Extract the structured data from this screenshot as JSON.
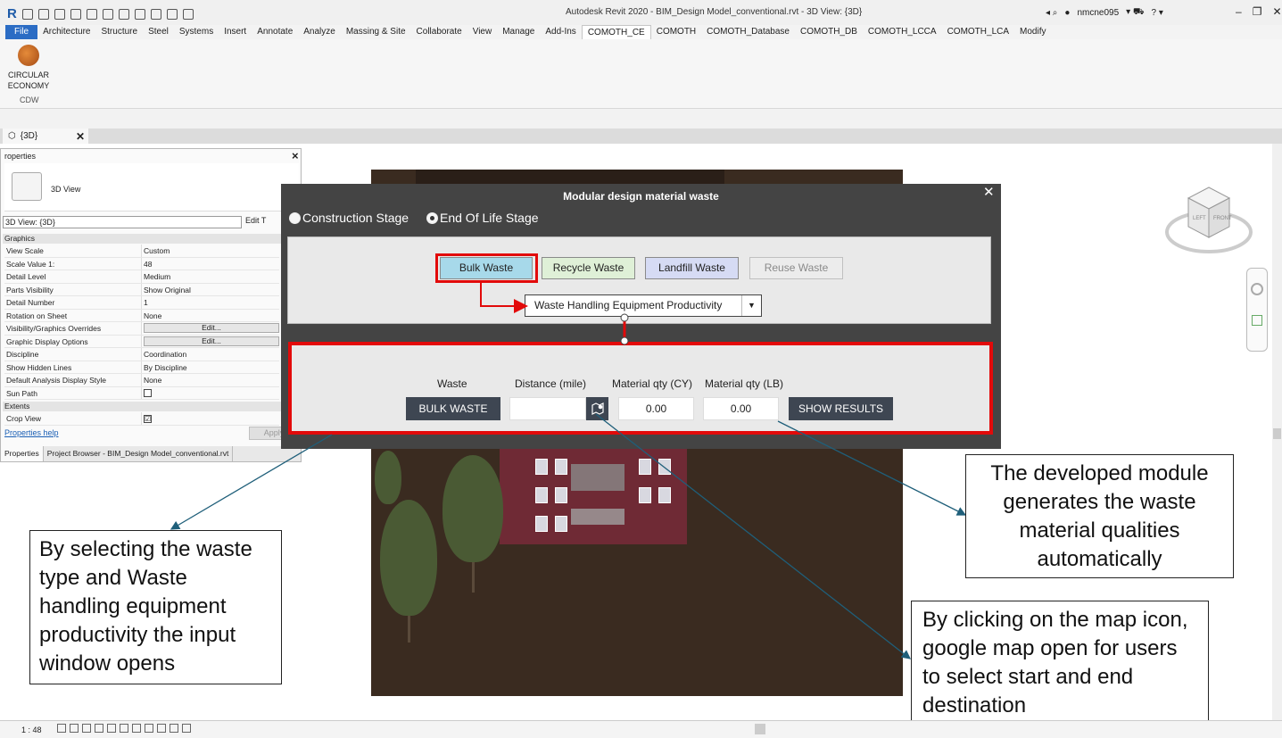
{
  "app": {
    "window_title": "Autodesk Revit 2020 - BIM_Design Model_conventional.rvt - 3D View: {3D}",
    "username": "nmcne095",
    "logo": "R"
  },
  "menu": {
    "items": [
      "File",
      "Architecture",
      "Structure",
      "Steel",
      "Systems",
      "Insert",
      "Annotate",
      "Analyze",
      "Massing & Site",
      "Collaborate",
      "View",
      "Manage",
      "Add-Ins",
      "COMOTH_CE",
      "COMOTH",
      "COMOTH_Database",
      "COMOTH_DB",
      "COMOTH_LCCA",
      "COMOTH_LCA",
      "Modify"
    ],
    "active": "COMOTH_CE"
  },
  "ribbon": {
    "circular_economy_label": "CIRCULAR ECONOMY",
    "panel_label": "CDW"
  },
  "view_tab": {
    "label": "{3D}",
    "close": "✕"
  },
  "properties": {
    "title": "roperties",
    "type_name": "3D View",
    "selector": "3D View: {3D}",
    "edit_type": "Edit T",
    "groups": {
      "graphics": "Graphics",
      "extents": "Extents"
    },
    "rows": [
      {
        "key": "View Scale",
        "value": "Custom"
      },
      {
        "key": "Scale Value    1:",
        "value": "48"
      },
      {
        "key": "Detail Level",
        "value": "Medium"
      },
      {
        "key": "Parts Visibility",
        "value": "Show Original"
      },
      {
        "key": "Detail Number",
        "value": "1"
      },
      {
        "key": "Rotation on Sheet",
        "value": "None"
      },
      {
        "key": "Visibility/Graphics Overrides",
        "value": "Edit..."
      },
      {
        "key": "Graphic Display Options",
        "value": "Edit..."
      },
      {
        "key": "Discipline",
        "value": "Coordination"
      },
      {
        "key": "Show Hidden Lines",
        "value": "By Discipline"
      },
      {
        "key": "Default Analysis Display Style",
        "value": "None"
      },
      {
        "key": "Sun Path",
        "value": ""
      }
    ],
    "extents_rows": [
      {
        "key": "Crop View",
        "value": "☑"
      }
    ],
    "help_link": "Properties help",
    "apply": "Apply",
    "tabs": [
      "Properties",
      "Project Browser - BIM_Design Model_conventional.rvt"
    ]
  },
  "dialog": {
    "title": "Modular design material waste",
    "close": "✕",
    "stage_options": [
      {
        "label": "Construction Stage",
        "selected": false
      },
      {
        "label": "End Of Life Stage",
        "selected": true
      }
    ],
    "waste_buttons": {
      "bulk": "Bulk Waste",
      "recycle": "Recycle Waste",
      "landfill": "Landfill Waste",
      "reuse": "Reuse Waste"
    },
    "equipment_select": "Waste Handling Equipment Productivity",
    "columns": {
      "waste": "Waste",
      "distance": "Distance (mile)",
      "qty_cy": "Material qty (CY)",
      "qty_lb": "Material qty (LB)"
    },
    "bulk_waste_button": "BULK WASTE",
    "distance_value": "",
    "qty_cy_value": "0.00",
    "qty_lb_value": "0.00",
    "show_results": "SHOW RESULTS"
  },
  "notes": {
    "left": "By selecting the waste type and Waste handling equipment productivity the input window opens",
    "right": "The developed module generates the waste material qualities automatically",
    "map": "By clicking on the map icon,  google map open for users to select start and end destination"
  },
  "status": {
    "scale": "1 : 48"
  },
  "colors": {
    "highlight_red": "#e20a0a",
    "dialog_bg": "#444444",
    "dark_button": "#3e4652",
    "arrow_blue": "#1f5f7a"
  }
}
